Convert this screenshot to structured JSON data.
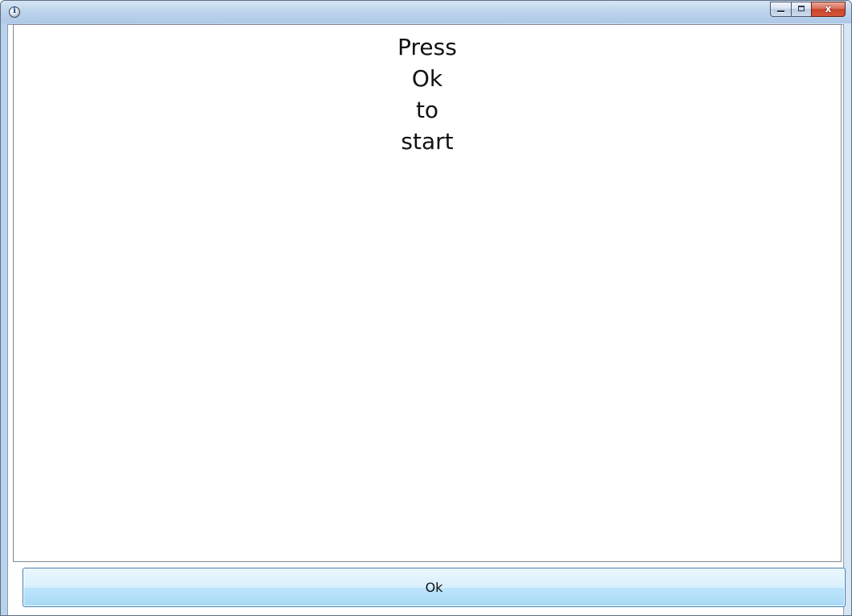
{
  "window": {
    "icon": "info-icon",
    "caption_buttons": {
      "minimize_icon": "minimize-icon",
      "maximize_icon": "maximize-icon",
      "close_glyph": "x"
    }
  },
  "message": {
    "lines": [
      "Press",
      "Ok",
      "to",
      "start"
    ]
  },
  "ok_button": {
    "label": "Ok"
  },
  "colors": {
    "button_border": "#3c7fb1",
    "close_button": "#c7442a",
    "text": "#111111"
  }
}
